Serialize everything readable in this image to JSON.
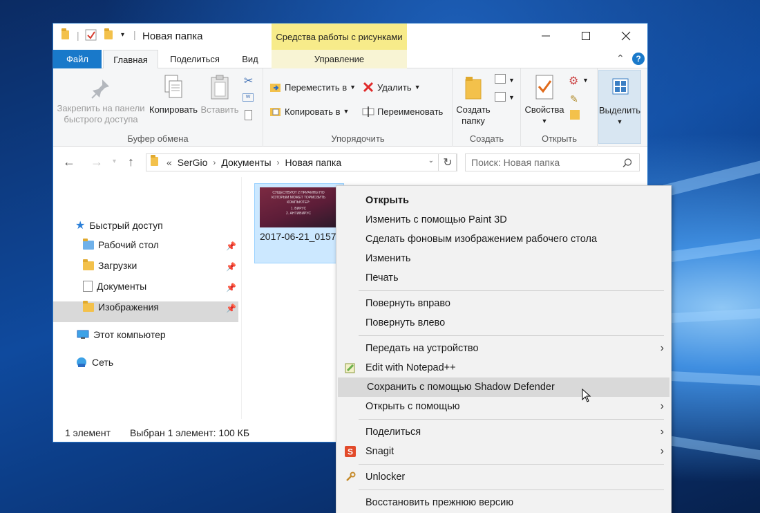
{
  "window": {
    "title": "Новая папка",
    "picture_tools_label": "Средства работы с рисунками",
    "manage_tab": "Управление"
  },
  "tabs": {
    "file": "Файл",
    "home": "Главная",
    "share": "Поделиться",
    "view": "Вид"
  },
  "ribbon": {
    "clipboard": {
      "pin": "Закрепить на панели быстрого доступа",
      "copy": "Копировать",
      "paste": "Вставить",
      "group": "Буфер обмена"
    },
    "organize": {
      "move_to": "Переместить в",
      "copy_to": "Копировать в",
      "delete": "Удалить",
      "rename": "Переименовать",
      "group": "Упорядочить"
    },
    "new": {
      "new_folder": "Создать папку",
      "group": "Создать"
    },
    "open": {
      "properties": "Свойства",
      "group": "Открыть"
    },
    "select": {
      "select": "Выделить"
    }
  },
  "address": {
    "prefix": "«",
    "crumbs": [
      "SerGio",
      "Документы",
      "Новая папка"
    ],
    "search_placeholder": "Поиск: Новая папка"
  },
  "nav": {
    "quick_access": "Быстрый доступ",
    "desktop": "Рабочий стол",
    "downloads": "Загрузки",
    "documents": "Документы",
    "pictures": "Изображения",
    "this_pc": "Этот компьютер",
    "network": "Сеть"
  },
  "file": {
    "name": "2017-06-21_0157",
    "thumb_lines": [
      "СУЩЕСТВУЮТ 2 ПРИЧИНЫ ПО",
      "КОТОРЫМ МОЖЕТ ТОРМОЗИТЬ",
      "КОМПЬЮТЕР:",
      "1. ВИРУС",
      "2. АНТИВИРУС"
    ]
  },
  "status": {
    "count": "1 элемент",
    "selected": "Выбран 1 элемент: 100 КБ"
  },
  "context_menu": {
    "open": "Открыть",
    "edit_paint3d": "Изменить с помощью Paint 3D",
    "set_wallpaper": "Сделать фоновым изображением рабочего стола",
    "edit": "Изменить",
    "print": "Печать",
    "rotate_right": "Повернуть вправо",
    "rotate_left": "Повернуть влево",
    "cast": "Передать на устройство",
    "notepadpp": "Edit with Notepad++",
    "shadow_defender": "Сохранить с помощью Shadow Defender",
    "open_with": "Открыть с помощью",
    "share": "Поделиться",
    "snagit": "Snagit",
    "unlocker": "Unlocker",
    "restore": "Восстановить прежнюю версию"
  },
  "colors": {
    "accent": "#1979ca",
    "tools_tab": "#f7eb8a",
    "menu_bg": "#f2f2f2",
    "hover": "#d9d9d9",
    "selection": "#cce8ff"
  }
}
